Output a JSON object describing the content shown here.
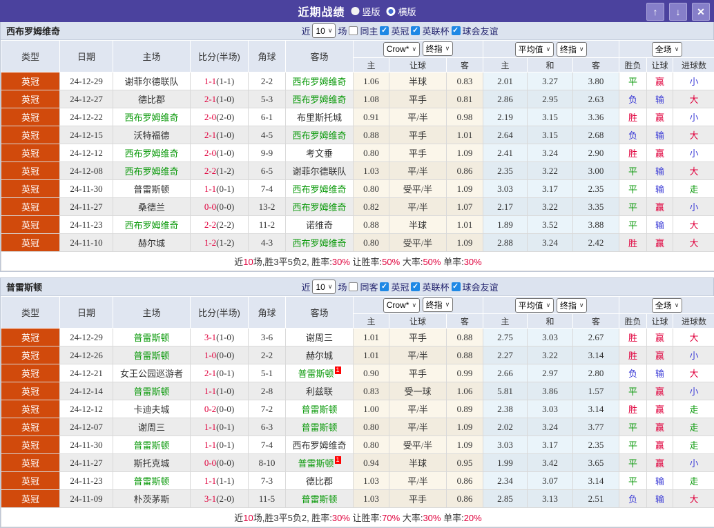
{
  "titlebar": {
    "title": "近期战绩",
    "vertical": "竖版",
    "horizontal": "横版",
    "icons": {
      "up": "↑",
      "down": "↓",
      "close": "✕"
    }
  },
  "colors": {
    "accent_purple": "#4b429e",
    "league_orange": "#d14a0c",
    "team_green": "#099909",
    "win_red": "#e0003c",
    "loss_blue": "#3a3ad6",
    "header_bg": "#e0e6f1"
  },
  "table_headers": {
    "main": [
      "类型",
      "日期",
      "主场",
      "比分(半场)",
      "角球",
      "客场"
    ],
    "sub": [
      "主",
      "让球",
      "客",
      "主",
      "和",
      "客",
      "胜负",
      "让球",
      "进球数"
    ]
  },
  "sections": [
    {
      "team": "西布罗姆维奇",
      "filter": {
        "prefix": "近",
        "count": "10",
        "suffix": "场",
        "same": "同主",
        "checks": [
          "英冠",
          "英联杯",
          "球会友谊"
        ]
      },
      "selects": {
        "bookie": "Crow*",
        "final_a": "终指",
        "avg": "平均值",
        "final_b": "终指",
        "scope": "全场"
      },
      "rows": [
        {
          "league": "英冠",
          "date": "24-12-29",
          "home": "谢菲尔德联队",
          "home_green": false,
          "home_card": "",
          "score": "1-1",
          "half": "(1-1)",
          "corner": "2-2",
          "away": "西布罗姆维奇",
          "away_green": true,
          "away_card": "",
          "crow": [
            "1.06",
            "半球",
            "0.83"
          ],
          "avg": [
            "2.01",
            "3.27",
            "3.80"
          ],
          "wdl": "平",
          "wdl_c": "green",
          "let": "赢",
          "let_c": "red",
          "goal": "小",
          "goal_c": "blue"
        },
        {
          "league": "英冠",
          "date": "24-12-27",
          "home": "德比郡",
          "home_green": false,
          "home_card": "",
          "score": "2-1",
          "half": "(1-0)",
          "corner": "5-3",
          "away": "西布罗姆维奇",
          "away_green": true,
          "away_card": "",
          "crow": [
            "1.08",
            "平手",
            "0.81"
          ],
          "avg": [
            "2.86",
            "2.95",
            "2.63"
          ],
          "wdl": "负",
          "wdl_c": "blue",
          "let": "输",
          "let_c": "blue",
          "goal": "大",
          "goal_c": "red"
        },
        {
          "league": "英冠",
          "date": "24-12-22",
          "home": "西布罗姆维奇",
          "home_green": true,
          "home_card": "",
          "score": "2-0",
          "half": "(2-0)",
          "corner": "6-1",
          "away": "布里斯托城",
          "away_green": false,
          "away_card": "",
          "crow": [
            "0.91",
            "平/半",
            "0.98"
          ],
          "avg": [
            "2.19",
            "3.15",
            "3.36"
          ],
          "wdl": "胜",
          "wdl_c": "red",
          "let": "赢",
          "let_c": "red",
          "goal": "小",
          "goal_c": "blue"
        },
        {
          "league": "英冠",
          "date": "24-12-15",
          "home": "沃特福德",
          "home_green": false,
          "home_card": "",
          "score": "2-1",
          "half": "(1-0)",
          "corner": "4-5",
          "away": "西布罗姆维奇",
          "away_green": true,
          "away_card": "",
          "crow": [
            "0.88",
            "平手",
            "1.01"
          ],
          "avg": [
            "2.64",
            "3.15",
            "2.68"
          ],
          "wdl": "负",
          "wdl_c": "blue",
          "let": "输",
          "let_c": "blue",
          "goal": "大",
          "goal_c": "red"
        },
        {
          "league": "英冠",
          "date": "24-12-12",
          "home": "西布罗姆维奇",
          "home_green": true,
          "home_card": "",
          "score": "2-0",
          "half": "(1-0)",
          "corner": "9-9",
          "away": "考文垂",
          "away_green": false,
          "away_card": "",
          "crow": [
            "0.80",
            "平手",
            "1.09"
          ],
          "avg": [
            "2.41",
            "3.24",
            "2.90"
          ],
          "wdl": "胜",
          "wdl_c": "red",
          "let": "赢",
          "let_c": "red",
          "goal": "小",
          "goal_c": "blue"
        },
        {
          "league": "英冠",
          "date": "24-12-08",
          "home": "西布罗姆维奇",
          "home_green": true,
          "home_card": "",
          "score": "2-2",
          "half": "(1-2)",
          "corner": "6-5",
          "away": "谢菲尔德联队",
          "away_green": false,
          "away_card": "",
          "crow": [
            "1.03",
            "平/半",
            "0.86"
          ],
          "avg": [
            "2.35",
            "3.22",
            "3.00"
          ],
          "wdl": "平",
          "wdl_c": "green",
          "let": "输",
          "let_c": "blue",
          "goal": "大",
          "goal_c": "red"
        },
        {
          "league": "英冠",
          "date": "24-11-30",
          "home": "普雷斯顿",
          "home_green": false,
          "home_card": "",
          "score": "1-1",
          "half": "(0-1)",
          "corner": "7-4",
          "away": "西布罗姆维奇",
          "away_green": true,
          "away_card": "",
          "crow": [
            "0.80",
            "受平/半",
            "1.09"
          ],
          "avg": [
            "3.03",
            "3.17",
            "2.35"
          ],
          "wdl": "平",
          "wdl_c": "green",
          "let": "输",
          "let_c": "blue",
          "goal": "走",
          "goal_c": "green"
        },
        {
          "league": "英冠",
          "date": "24-11-27",
          "home": "桑德兰",
          "home_green": false,
          "home_card": "",
          "score": "0-0",
          "half": "(0-0)",
          "corner": "13-2",
          "away": "西布罗姆维奇",
          "away_green": true,
          "away_card": "",
          "crow": [
            "0.82",
            "平/半",
            "1.07"
          ],
          "avg": [
            "2.17",
            "3.22",
            "3.35"
          ],
          "wdl": "平",
          "wdl_c": "green",
          "let": "赢",
          "let_c": "red",
          "goal": "小",
          "goal_c": "blue"
        },
        {
          "league": "英冠",
          "date": "24-11-23",
          "home": "西布罗姆维奇",
          "home_green": true,
          "home_card": "",
          "score": "2-2",
          "half": "(2-2)",
          "corner": "11-2",
          "away": "诺维奇",
          "away_green": false,
          "away_card": "",
          "crow": [
            "0.88",
            "半球",
            "1.01"
          ],
          "avg": [
            "1.89",
            "3.52",
            "3.88"
          ],
          "wdl": "平",
          "wdl_c": "green",
          "let": "输",
          "let_c": "blue",
          "goal": "大",
          "goal_c": "red"
        },
        {
          "league": "英冠",
          "date": "24-11-10",
          "home": "赫尔城",
          "home_green": false,
          "home_card": "",
          "score": "1-2",
          "half": "(1-2)",
          "corner": "4-3",
          "away": "西布罗姆维奇",
          "away_green": true,
          "away_card": "",
          "crow": [
            "0.80",
            "受平/半",
            "1.09"
          ],
          "avg": [
            "2.88",
            "3.24",
            "2.42"
          ],
          "wdl": "胜",
          "wdl_c": "red",
          "let": "赢",
          "let_c": "red",
          "goal": "大",
          "goal_c": "red"
        }
      ],
      "summary": [
        {
          "t": "近",
          "red": false
        },
        {
          "t": "10",
          "red": true
        },
        {
          "t": "场,胜3平5负2, 胜率:",
          "red": false
        },
        {
          "t": "30%",
          "red": true
        },
        {
          "t": " 让胜率:",
          "red": false
        },
        {
          "t": "50%",
          "red": true
        },
        {
          "t": " 大率:",
          "red": false
        },
        {
          "t": "50%",
          "red": true
        },
        {
          "t": " 单率:",
          "red": false
        },
        {
          "t": "30%",
          "red": true
        }
      ]
    },
    {
      "team": "普雷斯顿",
      "filter": {
        "prefix": "近",
        "count": "10",
        "suffix": "场",
        "same": "同客",
        "checks": [
          "英冠",
          "英联杯",
          "球会友谊"
        ]
      },
      "selects": {
        "bookie": "Crow*",
        "final_a": "终指",
        "avg": "平均值",
        "final_b": "终指",
        "scope": "全场"
      },
      "rows": [
        {
          "league": "英冠",
          "date": "24-12-29",
          "home": "普雷斯顿",
          "home_green": true,
          "home_card": "",
          "score": "3-1",
          "half": "(1-0)",
          "corner": "3-6",
          "away": "谢周三",
          "away_green": false,
          "away_card": "",
          "crow": [
            "1.01",
            "平手",
            "0.88"
          ],
          "avg": [
            "2.75",
            "3.03",
            "2.67"
          ],
          "wdl": "胜",
          "wdl_c": "red",
          "let": "赢",
          "let_c": "red",
          "goal": "大",
          "goal_c": "red"
        },
        {
          "league": "英冠",
          "date": "24-12-26",
          "home": "普雷斯顿",
          "home_green": true,
          "home_card": "",
          "score": "1-0",
          "half": "(0-0)",
          "corner": "2-2",
          "away": "赫尔城",
          "away_green": false,
          "away_card": "",
          "crow": [
            "1.01",
            "平/半",
            "0.88"
          ],
          "avg": [
            "2.27",
            "3.22",
            "3.14"
          ],
          "wdl": "胜",
          "wdl_c": "red",
          "let": "赢",
          "let_c": "red",
          "goal": "小",
          "goal_c": "blue"
        },
        {
          "league": "英冠",
          "date": "24-12-21",
          "home": "女王公园巡游者",
          "home_green": false,
          "home_card": "",
          "score": "2-1",
          "half": "(0-1)",
          "corner": "5-1",
          "away": "普雷斯顿",
          "away_green": true,
          "away_card": "1",
          "crow": [
            "0.90",
            "平手",
            "0.99"
          ],
          "avg": [
            "2.66",
            "2.97",
            "2.80"
          ],
          "wdl": "负",
          "wdl_c": "blue",
          "let": "输",
          "let_c": "blue",
          "goal": "大",
          "goal_c": "red"
        },
        {
          "league": "英冠",
          "date": "24-12-14",
          "home": "普雷斯顿",
          "home_green": true,
          "home_card": "",
          "score": "1-1",
          "half": "(1-0)",
          "corner": "2-8",
          "away": "利兹联",
          "away_green": false,
          "away_card": "",
          "crow": [
            "0.83",
            "受一球",
            "1.06"
          ],
          "avg": [
            "5.81",
            "3.86",
            "1.57"
          ],
          "wdl": "平",
          "wdl_c": "green",
          "let": "赢",
          "let_c": "red",
          "goal": "小",
          "goal_c": "blue"
        },
        {
          "league": "英冠",
          "date": "24-12-12",
          "home": "卡迪夫城",
          "home_green": false,
          "home_card": "",
          "score": "0-2",
          "half": "(0-0)",
          "corner": "7-2",
          "away": "普雷斯顿",
          "away_green": true,
          "away_card": "",
          "crow": [
            "1.00",
            "平/半",
            "0.89"
          ],
          "avg": [
            "2.38",
            "3.03",
            "3.14"
          ],
          "wdl": "胜",
          "wdl_c": "red",
          "let": "赢",
          "let_c": "red",
          "goal": "走",
          "goal_c": "green"
        },
        {
          "league": "英冠",
          "date": "24-12-07",
          "home": "谢周三",
          "home_green": false,
          "home_card": "",
          "score": "1-1",
          "half": "(0-1)",
          "corner": "6-3",
          "away": "普雷斯顿",
          "away_green": true,
          "away_card": "",
          "crow": [
            "0.80",
            "平/半",
            "1.09"
          ],
          "avg": [
            "2.02",
            "3.24",
            "3.77"
          ],
          "wdl": "平",
          "wdl_c": "green",
          "let": "赢",
          "let_c": "red",
          "goal": "走",
          "goal_c": "green"
        },
        {
          "league": "英冠",
          "date": "24-11-30",
          "home": "普雷斯顿",
          "home_green": true,
          "home_card": "",
          "score": "1-1",
          "half": "(0-1)",
          "corner": "7-4",
          "away": "西布罗姆维奇",
          "away_green": false,
          "away_card": "",
          "crow": [
            "0.80",
            "受平/半",
            "1.09"
          ],
          "avg": [
            "3.03",
            "3.17",
            "2.35"
          ],
          "wdl": "平",
          "wdl_c": "green",
          "let": "赢",
          "let_c": "red",
          "goal": "走",
          "goal_c": "green"
        },
        {
          "league": "英冠",
          "date": "24-11-27",
          "home": "斯托克城",
          "home_green": false,
          "home_card": "",
          "score": "0-0",
          "half": "(0-0)",
          "corner": "8-10",
          "away": "普雷斯顿",
          "away_green": true,
          "away_card": "1",
          "crow": [
            "0.94",
            "半球",
            "0.95"
          ],
          "avg": [
            "1.99",
            "3.42",
            "3.65"
          ],
          "wdl": "平",
          "wdl_c": "green",
          "let": "赢",
          "let_c": "red",
          "goal": "小",
          "goal_c": "blue"
        },
        {
          "league": "英冠",
          "date": "24-11-23",
          "home": "普雷斯顿",
          "home_green": true,
          "home_card": "",
          "score": "1-1",
          "half": "(1-1)",
          "corner": "7-3",
          "away": "德比郡",
          "away_green": false,
          "away_card": "",
          "crow": [
            "1.03",
            "平/半",
            "0.86"
          ],
          "avg": [
            "2.34",
            "3.07",
            "3.14"
          ],
          "wdl": "平",
          "wdl_c": "green",
          "let": "输",
          "let_c": "blue",
          "goal": "走",
          "goal_c": "green"
        },
        {
          "league": "英冠",
          "date": "24-11-09",
          "home": "朴茨茅斯",
          "home_green": false,
          "home_card": "",
          "score": "3-1",
          "half": "(2-0)",
          "corner": "11-5",
          "away": "普雷斯顿",
          "away_green": true,
          "away_card": "",
          "crow": [
            "1.03",
            "平手",
            "0.86"
          ],
          "avg": [
            "2.85",
            "3.13",
            "2.51"
          ],
          "wdl": "负",
          "wdl_c": "blue",
          "let": "输",
          "let_c": "blue",
          "goal": "大",
          "goal_c": "red"
        }
      ],
      "summary": [
        {
          "t": "近",
          "red": false
        },
        {
          "t": "10",
          "red": true
        },
        {
          "t": "场,胜3平5负2, 胜率:",
          "red": false
        },
        {
          "t": "30%",
          "red": true
        },
        {
          "t": " 让胜率:",
          "red": false
        },
        {
          "t": "70%",
          "red": true
        },
        {
          "t": " 大率:",
          "red": false
        },
        {
          "t": "30%",
          "red": true
        },
        {
          "t": " 单率:",
          "red": false
        },
        {
          "t": "20%",
          "red": true
        }
      ]
    }
  ]
}
